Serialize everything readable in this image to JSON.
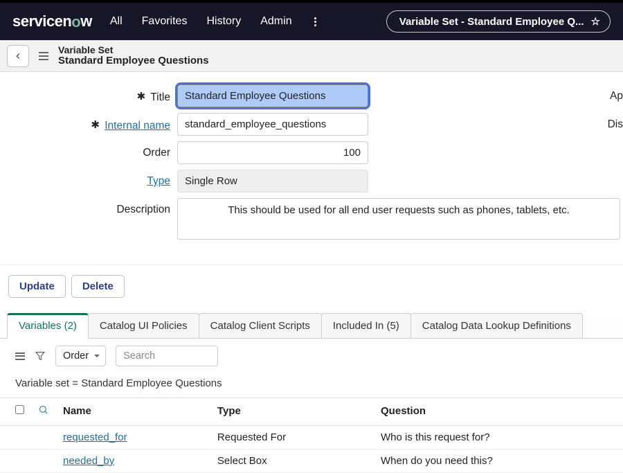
{
  "nav": {
    "all": "All",
    "favorites": "Favorites",
    "history": "History",
    "admin": "Admin",
    "pill_text": "Variable Set - Standard Employee Q..."
  },
  "subheader": {
    "label": "Variable Set",
    "title": "Standard Employee Questions"
  },
  "form": {
    "title_label": "Title",
    "title_value": "Standard Employee Questions",
    "internal_name_label": "Internal name",
    "internal_name_value": "standard_employee_questions",
    "order_label": "Order",
    "order_value": "100",
    "type_label": "Type",
    "type_value": "Single Row",
    "description_label": "Description",
    "description_value": "This should be used for all end user requests such as phones, tablets, etc.",
    "right_hint_1": "Ap",
    "right_hint_2": "Dis"
  },
  "actions": {
    "update": "Update",
    "delete": "Delete"
  },
  "tabs": {
    "variables": "Variables (2)",
    "catalog_ui": "Catalog UI Policies",
    "catalog_client": "Catalog Client Scripts",
    "included_in": "Included In (5)",
    "lookup": "Catalog Data Lookup Definitions"
  },
  "list": {
    "order_select": "Order",
    "search_placeholder": "Search",
    "breadcrumb": "Variable set = Standard Employee Questions",
    "cols": {
      "name": "Name",
      "type": "Type",
      "question": "Question"
    },
    "rows": [
      {
        "name": "requested_for",
        "type": "Requested For",
        "question": "Who is this request for?"
      },
      {
        "name": "needed_by",
        "type": "Select Box",
        "question": "When do you need this?"
      }
    ]
  }
}
